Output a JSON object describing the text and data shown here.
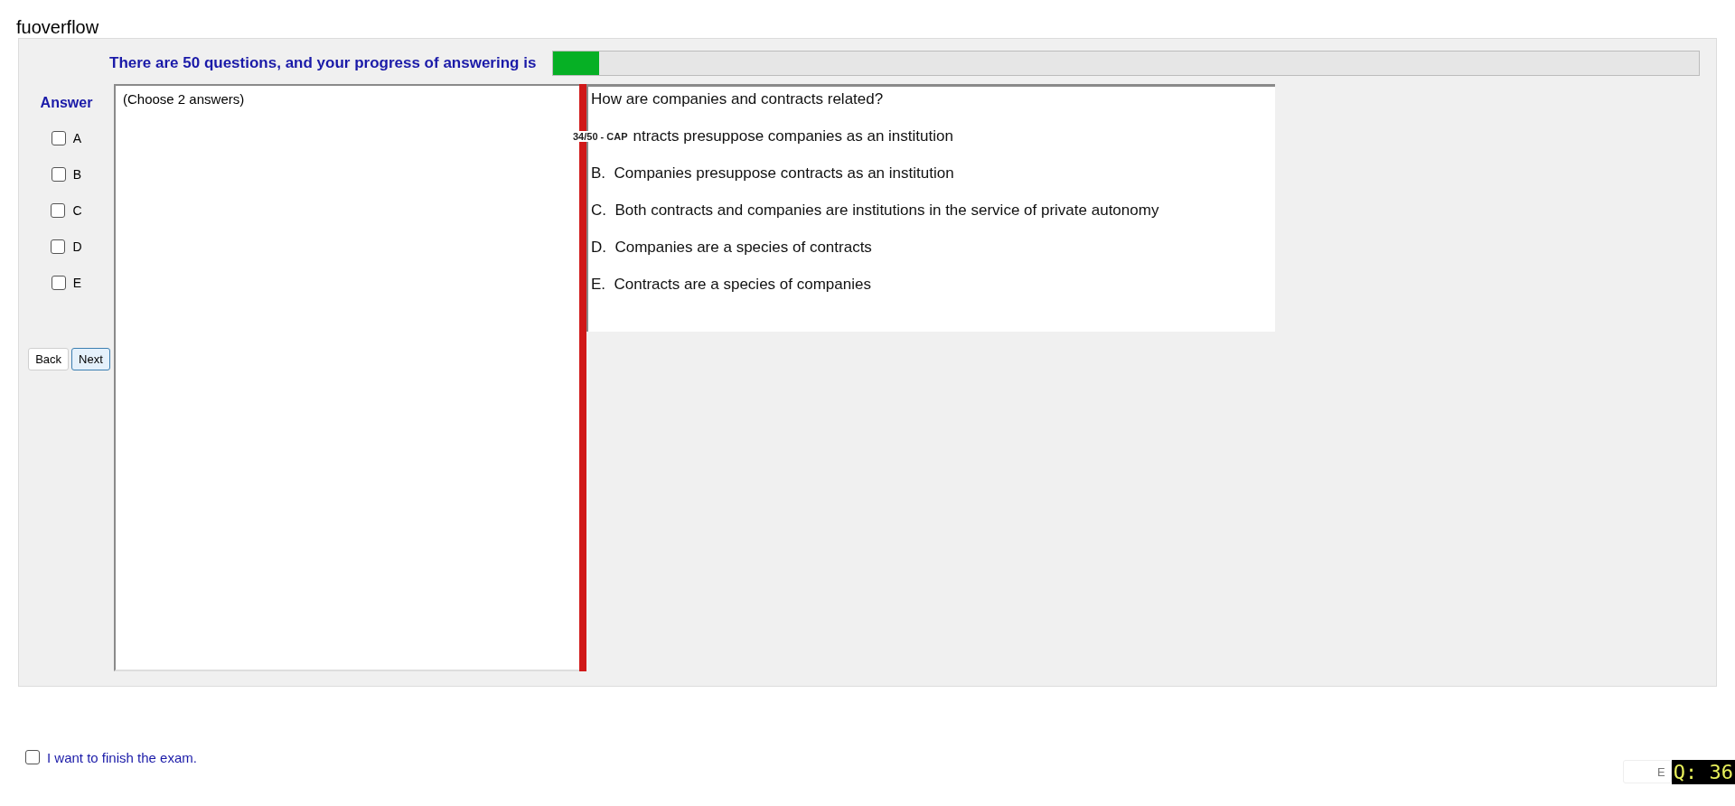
{
  "user_name": "fuoverflow",
  "progress": {
    "label": "There are 50 questions, and your progress of answering is",
    "level": 0.04
  },
  "answer": {
    "title": "Answer",
    "options": [
      {
        "letter": "A",
        "checked": false
      },
      {
        "letter": "B",
        "checked": false
      },
      {
        "letter": "C",
        "checked": false
      },
      {
        "letter": "D",
        "checked": false
      },
      {
        "letter": "E",
        "checked": false
      }
    ],
    "buttons": [
      {
        "label": "Back",
        "selected": false
      },
      {
        "label": "Next",
        "selected": true
      }
    ],
    "note": "(Choose 2 answers)"
  },
  "question_tag": "34/50 - CAP",
  "question": {
    "text": "How are companies and contracts related?",
    "choices": [
      {
        "text": "ntracts presuppose companies as an institution"
      },
      {
        "letter": "B.",
        "text": "Companies presuppose contracts as an institution"
      },
      {
        "letter": "C.",
        "text": "Both contracts and companies are institutions in the service of private autonomy"
      },
      {
        "letter": "D.",
        "text": "Companies are a species of contracts"
      },
      {
        "letter": "E.",
        "text": "Contracts are a species of companies"
      }
    ]
  },
  "finish": {
    "label": "I want to finish the exam.",
    "checked": false
  },
  "exit_button": "E",
  "question_counter": "Q: 36"
}
